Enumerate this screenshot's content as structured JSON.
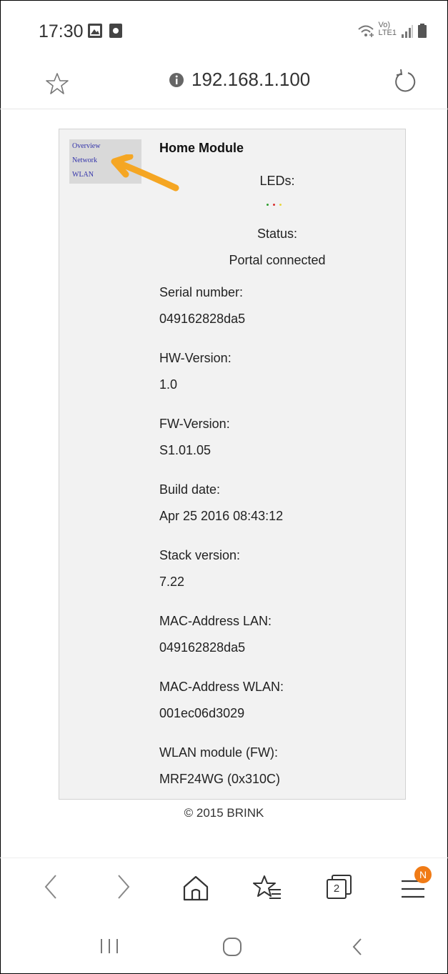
{
  "status_bar": {
    "time": "17:30",
    "icons": [
      "gallery-icon",
      "record-icon",
      "wifi-calling-icon",
      "volte-label",
      "signal-icon",
      "battery-icon"
    ],
    "network_label_top": "Vo)",
    "network_label_bottom": "LTE1"
  },
  "browser": {
    "url": "192.168.1.100",
    "tab_count": "2",
    "menu_badge": "N"
  },
  "page": {
    "nav": {
      "overview": "Overview",
      "network": "Network",
      "wlan": "WLAN"
    },
    "title": "Home Module",
    "leds_label": "LEDs:",
    "led_colors": [
      "#2e9e2e",
      "#d83030",
      "#e8d640"
    ],
    "status_label": "Status:",
    "status_value": "Portal connected",
    "fields": [
      {
        "label": "Serial number:",
        "value": "049162828da5"
      },
      {
        "label": "HW-Version:",
        "value": "1.0"
      },
      {
        "label": "FW-Version:",
        "value": "S1.01.05"
      },
      {
        "label": "Build date:",
        "value": "Apr 25 2016 08:43:12"
      },
      {
        "label": "Stack version:",
        "value": "7.22"
      },
      {
        "label": "MAC-Address LAN:",
        "value": "049162828da5"
      },
      {
        "label": "MAC-Address WLAN:",
        "value": "001ec06d3029"
      },
      {
        "label": "WLAN module (FW):",
        "value": "MRF24WG (0x310C)"
      }
    ],
    "copyright": "© 2015 BRINK"
  },
  "annotation": {
    "color": "#f5a623"
  }
}
